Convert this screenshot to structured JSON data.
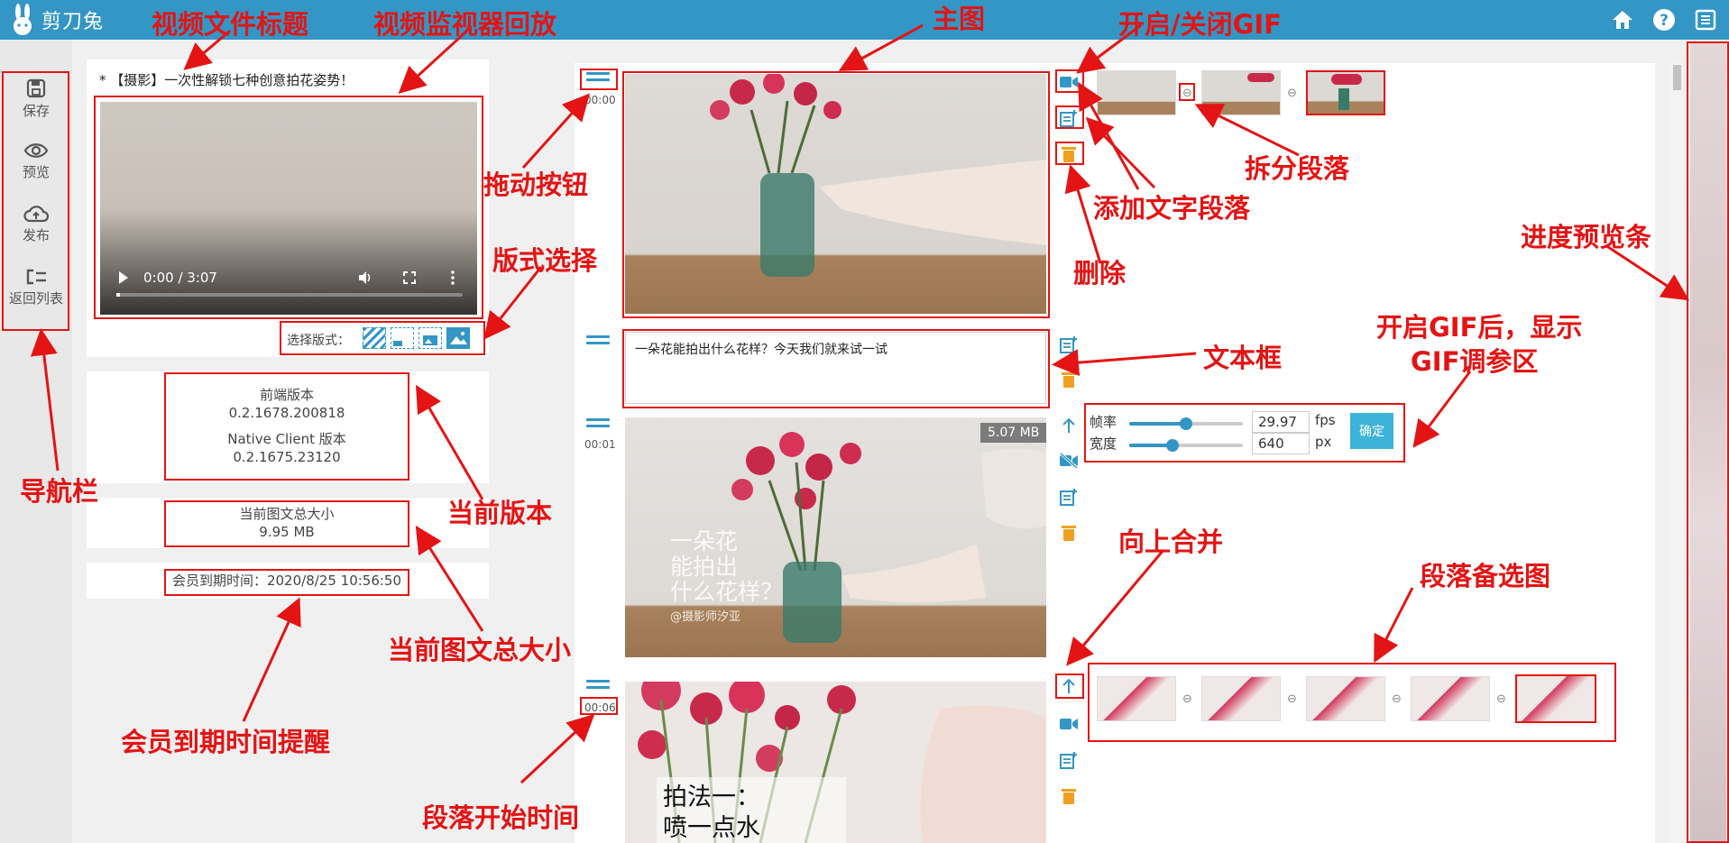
{
  "app": {
    "name": "剪刀兔"
  },
  "nav": [
    {
      "label": "保存",
      "icon": "save-icon"
    },
    {
      "label": "预览",
      "icon": "eye-icon"
    },
    {
      "label": "发布",
      "icon": "cloud-upload-icon"
    },
    {
      "label": "返回列表",
      "icon": "return-list-icon"
    }
  ],
  "top_icons": [
    "home-icon",
    "help-icon",
    "list-icon"
  ],
  "video": {
    "title": "* 【摄影】一次性解锁七种创意拍花姿势！",
    "time": "0:00 / 3:07",
    "progress": 0.01
  },
  "layout": {
    "label": "选择版式："
  },
  "version": {
    "frontend_label": "前端版本",
    "frontend_value": "0.2.1678.200818",
    "native_label": "Native Client 版本",
    "native_value": "0.2.1675.23120"
  },
  "total_size": {
    "label": "当前图文总大小",
    "value": "9.95 MB"
  },
  "membership": {
    "text": "会员到期时间：2020/8/25 10:56:50"
  },
  "segments": {
    "s1_time": "00:00",
    "s2_text": "一朵花能拍出什么花样？今天我们就来试一试",
    "s3_time": "00:01",
    "s3_size": "5.07 MB",
    "s3_overlay": [
      "一朵花",
      "能拍出",
      "什么花样？",
      "@摄影师汐亚"
    ],
    "s4_time": "00:06",
    "s4_overlay": [
      "拍法一：",
      "喷一点水"
    ]
  },
  "gif": {
    "framerate_label": "帧率",
    "framerate_value": "29.97",
    "framerate_unit": "fps",
    "framerate_level": 0.5,
    "width_label": "宽度",
    "width_value": "640",
    "width_unit": "px",
    "width_level": 0.38,
    "ok_label": "确定"
  },
  "annotations": {
    "file_title": "视频文件标题",
    "monitor": "视频监视器回放",
    "main_image": "主图",
    "gif_toggle": "开启/关闭GIF",
    "drag_button": "拖动按钮",
    "split": "拆分段落",
    "add_text": "添加文字段落",
    "layout_select": "版式选择",
    "delete": "删除",
    "progress_strip": "进度预览条",
    "gif_params_1": "开启GIF后，显示",
    "gif_params_2": "GIF调参区",
    "textbox": "文本框",
    "navbar": "导航栏",
    "current_version": "当前版本",
    "merge_up": "向上合并",
    "alt_images": "段落备选图",
    "total_size": "当前图文总大小",
    "member_expiry": "会员到期时间提醒",
    "start_time": "段落开始时间"
  },
  "colors": {
    "topbar": "#3396c4",
    "accent": "#3396c4",
    "delete": "#f0a020",
    "annotation": "#e41414"
  }
}
